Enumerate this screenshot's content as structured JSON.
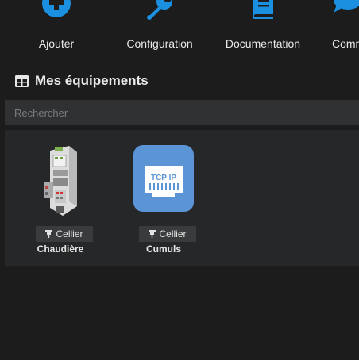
{
  "toolbar": {
    "items": [
      {
        "label": "Ajouter",
        "icon": "plus-circle-icon"
      },
      {
        "label": "Configuration",
        "icon": "wrench-icon"
      },
      {
        "label": "Documentation",
        "icon": "book-icon"
      },
      {
        "label": "Comm",
        "icon": "comment-icon"
      }
    ],
    "accent": "#1b8fe0"
  },
  "section": {
    "title": "Mes équipements",
    "icon": "table-icon"
  },
  "search": {
    "placeholder": "Rechercher",
    "value": ""
  },
  "equipments": [
    {
      "room": "Cellier",
      "name": "Chaudière",
      "icon": "plc-device-icon",
      "room_icon": "pin-icon"
    },
    {
      "room": "Cellier",
      "name": "Cumuls",
      "icon": "tcp-ip-icon",
      "room_icon": "pin-icon",
      "tile_text": "TCP IP",
      "tile_color": "#5b95d6"
    }
  ]
}
